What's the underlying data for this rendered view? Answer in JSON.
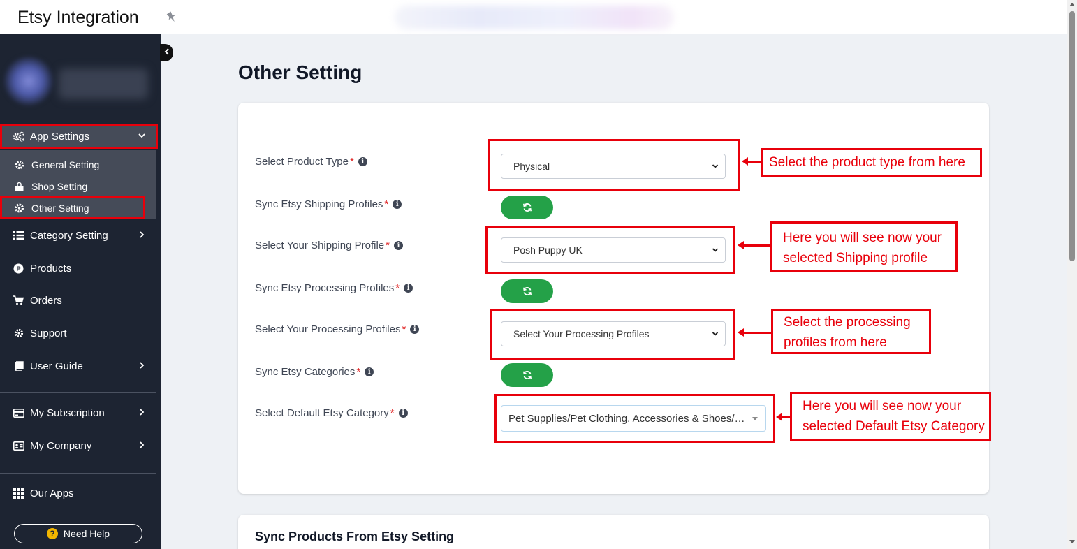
{
  "topbar": {
    "title": "Etsy Integration"
  },
  "sidebar": {
    "app_settings": "App Settings",
    "submenu": [
      "General Setting",
      "Shop Setting",
      "Other Setting"
    ],
    "items": {
      "category_setting": "Category Setting",
      "products": "Products",
      "orders": "Orders",
      "support": "Support",
      "user_guide": "User Guide",
      "my_subscription": "My Subscription",
      "my_company": "My Company",
      "our_apps": "Our Apps"
    },
    "need_help": "Need Help"
  },
  "main": {
    "page_title": "Other Setting",
    "form": {
      "product_type": {
        "label": "Select Product Type",
        "value": "Physical"
      },
      "sync_shipping": {
        "label": "Sync Etsy Shipping Profiles "
      },
      "shipping_profile": {
        "label": "Select Your Shipping Profile",
        "value": "Posh Puppy UK"
      },
      "sync_processing": {
        "label": "Sync Etsy Processing Profiles "
      },
      "processing_profiles": {
        "label": "Select Your Processing Profiles",
        "value": "Select Your Processing Profiles"
      },
      "sync_categories": {
        "label": "Sync Etsy Categories "
      },
      "default_category": {
        "label": "Select Default Etsy Category",
        "value": "Pet Supplies/Pet Clothing, Accessories & Shoes/…"
      }
    },
    "sync_products_title": "Sync Products From Etsy Setting"
  },
  "annotations": {
    "product_type": "Select the product type from here",
    "shipping_line1": "Here you will see now your",
    "shipping_line2": "selected Shipping profile",
    "processing_line1": "Select the processing",
    "processing_line2": "profiles from here",
    "category_line1": "Here you will see now your",
    "category_line2": "selected Default Etsy Category"
  },
  "colors": {
    "annotation_red": "#e8000b",
    "sync_green": "#24a148",
    "sidebar_bg": "#1d2432"
  },
  "icons": [
    "pin-icon",
    "gears-icon",
    "gear-icon",
    "bag-icon",
    "list-icon",
    "p-circle-icon",
    "cart-icon",
    "book-icon",
    "card-icon",
    "id-card-icon",
    "grid-icon",
    "question-icon",
    "info-icon",
    "refresh-icon",
    "chevron-down-icon",
    "chevron-right-icon",
    "chevron-left-icon"
  ]
}
